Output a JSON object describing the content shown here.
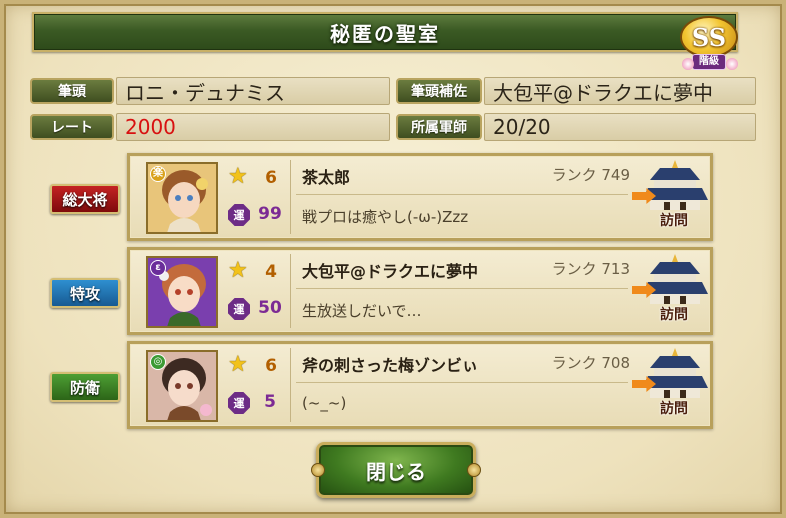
{
  "dialog": {
    "title": "秘匿の聖室",
    "rank_badge": {
      "grade": "SS",
      "label": "階級"
    },
    "close_label": "閉じる"
  },
  "info": {
    "leader_label": "筆頭",
    "leader_value": "ロニ・デュナミス",
    "sub_leader_label": "筆頭補佐",
    "sub_leader_value": "大包平@ドラクエに夢中",
    "rate_label": "レート",
    "rate_value": "2000",
    "members_label": "所属軍師",
    "members_value": "20/20"
  },
  "entries": [
    {
      "role": "総大将",
      "role_color": "#a01515",
      "attr": "楽",
      "attr_color": "#d9a21c",
      "stars": "6",
      "luck_icon": "運",
      "luck": "99",
      "name": "茶太郎",
      "rank": "ランク 749",
      "comment": "戦プロは癒やし(-ω-)Zzz",
      "visit_label": "訪問"
    },
    {
      "role": "特攻",
      "role_color": "#1f73b3",
      "attr": "ε",
      "attr_color": "#6a2d9a",
      "stars": "4",
      "luck_icon": "運",
      "luck": "50",
      "name": "大包平@ドラクエに夢中",
      "rank": "ランク 713",
      "comment": "生放送しだいで…",
      "visit_label": "訪問"
    },
    {
      "role": "防衛",
      "role_color": "#3a8223",
      "attr": "◎",
      "attr_color": "#3c9a34",
      "stars": "6",
      "luck_icon": "運",
      "luck": "5",
      "name": "斧の刺さった梅ゾンビぃ",
      "rank": "ランク 708",
      "comment": "(~_~)",
      "visit_label": "訪問"
    }
  ]
}
